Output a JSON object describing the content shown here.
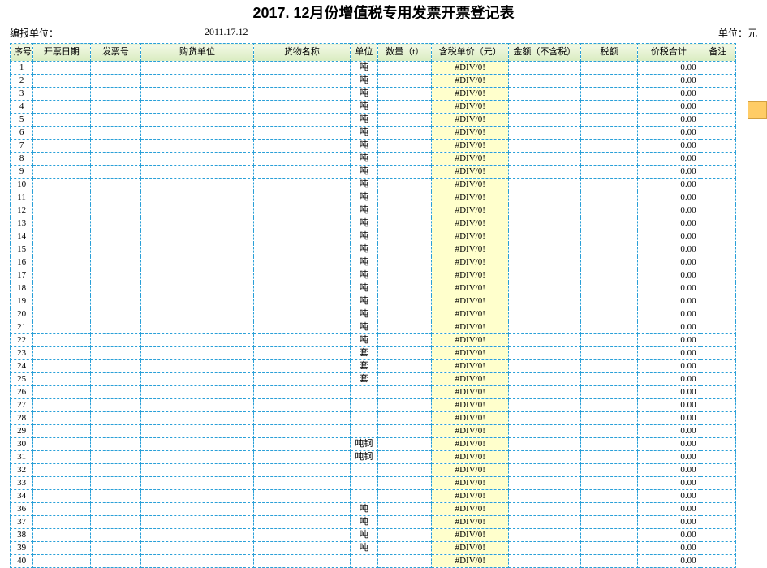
{
  "title": "2017. 12月份增值税专用发票开票登记表",
  "meta": {
    "left_label": "编报单位：",
    "date": "2011.17.12",
    "right_label": "单位：元"
  },
  "headers": {
    "seq": "序号",
    "date": "开票日期",
    "inv": "发票号",
    "buyer": "购货单位",
    "goods": "货物名称",
    "unit": "单位",
    "qty": "数量（t）",
    "price": "含税单价（元）",
    "amt": "金额（不含税）",
    "tax": "税额",
    "total": "价税合计",
    "note": "备注"
  },
  "rows": [
    {
      "seq": 1,
      "unit": "吨",
      "price": "#DIV/0!",
      "total": "0.00"
    },
    {
      "seq": 2,
      "unit": "吨",
      "price": "#DIV/0!",
      "total": "0.00"
    },
    {
      "seq": 3,
      "unit": "吨",
      "price": "#DIV/0!",
      "total": "0.00"
    },
    {
      "seq": 4,
      "unit": "吨",
      "price": "#DIV/0!",
      "total": "0.00"
    },
    {
      "seq": 5,
      "unit": "吨",
      "price": "#DIV/0!",
      "total": "0.00"
    },
    {
      "seq": 6,
      "unit": "吨",
      "price": "#DIV/0!",
      "total": "0.00"
    },
    {
      "seq": 7,
      "unit": "吨",
      "price": "#DIV/0!",
      "total": "0.00"
    },
    {
      "seq": 8,
      "unit": "吨",
      "price": "#DIV/0!",
      "total": "0.00"
    },
    {
      "seq": 9,
      "unit": "吨",
      "price": "#DIV/0!",
      "total": "0.00"
    },
    {
      "seq": 10,
      "unit": "吨",
      "price": "#DIV/0!",
      "total": "0.00"
    },
    {
      "seq": 11,
      "unit": "吨",
      "price": "#DIV/0!",
      "total": "0.00"
    },
    {
      "seq": 12,
      "unit": "吨",
      "price": "#DIV/0!",
      "total": "0.00"
    },
    {
      "seq": 13,
      "unit": "吨",
      "price": "#DIV/0!",
      "total": "0.00"
    },
    {
      "seq": 14,
      "unit": "吨",
      "price": "#DIV/0!",
      "total": "0.00"
    },
    {
      "seq": 15,
      "unit": "吨",
      "price": "#DIV/0!",
      "total": "0.00"
    },
    {
      "seq": 16,
      "unit": "吨",
      "price": "#DIV/0!",
      "total": "0.00"
    },
    {
      "seq": 17,
      "unit": "吨",
      "price": "#DIV/0!",
      "total": "0.00"
    },
    {
      "seq": 18,
      "unit": "吨",
      "price": "#DIV/0!",
      "total": "0.00"
    },
    {
      "seq": 19,
      "unit": "吨",
      "price": "#DIV/0!",
      "total": "0.00"
    },
    {
      "seq": 20,
      "unit": "吨",
      "price": "#DIV/0!",
      "total": "0.00"
    },
    {
      "seq": 21,
      "unit": "吨",
      "price": "#DIV/0!",
      "total": "0.00"
    },
    {
      "seq": 22,
      "unit": "吨",
      "price": "#DIV/0!",
      "total": "0.00"
    },
    {
      "seq": 23,
      "unit": "套",
      "price": "#DIV/0!",
      "total": "0.00"
    },
    {
      "seq": 24,
      "unit": "套",
      "price": "#DIV/0!",
      "total": "0.00"
    },
    {
      "seq": 25,
      "unit": "套",
      "price": "#DIV/0!",
      "total": "0.00"
    },
    {
      "seq": 26,
      "unit": "",
      "price": "#DIV/0!",
      "total": "0.00"
    },
    {
      "seq": 27,
      "unit": "",
      "price": "#DIV/0!",
      "total": "0.00"
    },
    {
      "seq": 28,
      "unit": "",
      "price": "#DIV/0!",
      "total": "0.00"
    },
    {
      "seq": 29,
      "unit": "",
      "price": "#DIV/0!",
      "total": "0.00"
    },
    {
      "seq": 30,
      "unit": "吨钢",
      "price": "#DIV/0!",
      "total": "0.00"
    },
    {
      "seq": 31,
      "unit": "吨钢",
      "price": "#DIV/0!",
      "total": "0.00"
    },
    {
      "seq": 32,
      "unit": "",
      "price": "#DIV/0!",
      "total": "0.00"
    },
    {
      "seq": 33,
      "unit": "",
      "price": "#DIV/0!",
      "total": "0.00"
    },
    {
      "seq": 34,
      "unit": "",
      "price": "#DIV/0!",
      "total": "0.00"
    },
    {
      "seq": 36,
      "unit": "吨",
      "price": "#DIV/0!",
      "total": "0.00"
    },
    {
      "seq": 37,
      "unit": "吨",
      "price": "#DIV/0!",
      "total": "0.00"
    },
    {
      "seq": 38,
      "unit": "吨",
      "price": "#DIV/0!",
      "total": "0.00"
    },
    {
      "seq": 39,
      "unit": "吨",
      "price": "#DIV/0!",
      "total": "0.00"
    },
    {
      "seq": 40,
      "unit": "",
      "price": "#DIV/0!",
      "total": "0.00"
    }
  ]
}
